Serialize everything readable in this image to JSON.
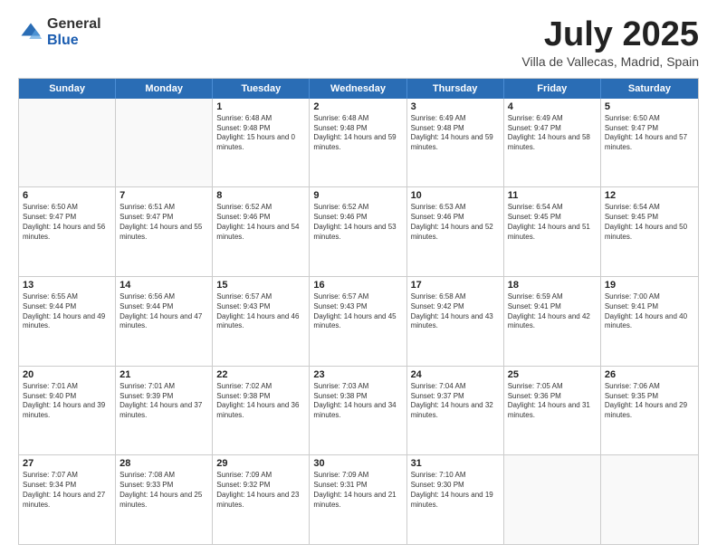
{
  "logo": {
    "general": "General",
    "blue": "Blue"
  },
  "header": {
    "title": "July 2025",
    "subtitle": "Villa de Vallecas, Madrid, Spain"
  },
  "calendar": {
    "days": [
      "Sunday",
      "Monday",
      "Tuesday",
      "Wednesday",
      "Thursday",
      "Friday",
      "Saturday"
    ],
    "rows": [
      [
        {
          "day": "",
          "empty": true
        },
        {
          "day": "",
          "empty": true
        },
        {
          "day": "1",
          "sunrise": "Sunrise: 6:48 AM",
          "sunset": "Sunset: 9:48 PM",
          "daylight": "Daylight: 15 hours and 0 minutes."
        },
        {
          "day": "2",
          "sunrise": "Sunrise: 6:48 AM",
          "sunset": "Sunset: 9:48 PM",
          "daylight": "Daylight: 14 hours and 59 minutes."
        },
        {
          "day": "3",
          "sunrise": "Sunrise: 6:49 AM",
          "sunset": "Sunset: 9:48 PM",
          "daylight": "Daylight: 14 hours and 59 minutes."
        },
        {
          "day": "4",
          "sunrise": "Sunrise: 6:49 AM",
          "sunset": "Sunset: 9:47 PM",
          "daylight": "Daylight: 14 hours and 58 minutes."
        },
        {
          "day": "5",
          "sunrise": "Sunrise: 6:50 AM",
          "sunset": "Sunset: 9:47 PM",
          "daylight": "Daylight: 14 hours and 57 minutes."
        }
      ],
      [
        {
          "day": "6",
          "sunrise": "Sunrise: 6:50 AM",
          "sunset": "Sunset: 9:47 PM",
          "daylight": "Daylight: 14 hours and 56 minutes."
        },
        {
          "day": "7",
          "sunrise": "Sunrise: 6:51 AM",
          "sunset": "Sunset: 9:47 PM",
          "daylight": "Daylight: 14 hours and 55 minutes."
        },
        {
          "day": "8",
          "sunrise": "Sunrise: 6:52 AM",
          "sunset": "Sunset: 9:46 PM",
          "daylight": "Daylight: 14 hours and 54 minutes."
        },
        {
          "day": "9",
          "sunrise": "Sunrise: 6:52 AM",
          "sunset": "Sunset: 9:46 PM",
          "daylight": "Daylight: 14 hours and 53 minutes."
        },
        {
          "day": "10",
          "sunrise": "Sunrise: 6:53 AM",
          "sunset": "Sunset: 9:46 PM",
          "daylight": "Daylight: 14 hours and 52 minutes."
        },
        {
          "day": "11",
          "sunrise": "Sunrise: 6:54 AM",
          "sunset": "Sunset: 9:45 PM",
          "daylight": "Daylight: 14 hours and 51 minutes."
        },
        {
          "day": "12",
          "sunrise": "Sunrise: 6:54 AM",
          "sunset": "Sunset: 9:45 PM",
          "daylight": "Daylight: 14 hours and 50 minutes."
        }
      ],
      [
        {
          "day": "13",
          "sunrise": "Sunrise: 6:55 AM",
          "sunset": "Sunset: 9:44 PM",
          "daylight": "Daylight: 14 hours and 49 minutes."
        },
        {
          "day": "14",
          "sunrise": "Sunrise: 6:56 AM",
          "sunset": "Sunset: 9:44 PM",
          "daylight": "Daylight: 14 hours and 47 minutes."
        },
        {
          "day": "15",
          "sunrise": "Sunrise: 6:57 AM",
          "sunset": "Sunset: 9:43 PM",
          "daylight": "Daylight: 14 hours and 46 minutes."
        },
        {
          "day": "16",
          "sunrise": "Sunrise: 6:57 AM",
          "sunset": "Sunset: 9:43 PM",
          "daylight": "Daylight: 14 hours and 45 minutes."
        },
        {
          "day": "17",
          "sunrise": "Sunrise: 6:58 AM",
          "sunset": "Sunset: 9:42 PM",
          "daylight": "Daylight: 14 hours and 43 minutes."
        },
        {
          "day": "18",
          "sunrise": "Sunrise: 6:59 AM",
          "sunset": "Sunset: 9:41 PM",
          "daylight": "Daylight: 14 hours and 42 minutes."
        },
        {
          "day": "19",
          "sunrise": "Sunrise: 7:00 AM",
          "sunset": "Sunset: 9:41 PM",
          "daylight": "Daylight: 14 hours and 40 minutes."
        }
      ],
      [
        {
          "day": "20",
          "sunrise": "Sunrise: 7:01 AM",
          "sunset": "Sunset: 9:40 PM",
          "daylight": "Daylight: 14 hours and 39 minutes."
        },
        {
          "day": "21",
          "sunrise": "Sunrise: 7:01 AM",
          "sunset": "Sunset: 9:39 PM",
          "daylight": "Daylight: 14 hours and 37 minutes."
        },
        {
          "day": "22",
          "sunrise": "Sunrise: 7:02 AM",
          "sunset": "Sunset: 9:38 PM",
          "daylight": "Daylight: 14 hours and 36 minutes."
        },
        {
          "day": "23",
          "sunrise": "Sunrise: 7:03 AM",
          "sunset": "Sunset: 9:38 PM",
          "daylight": "Daylight: 14 hours and 34 minutes."
        },
        {
          "day": "24",
          "sunrise": "Sunrise: 7:04 AM",
          "sunset": "Sunset: 9:37 PM",
          "daylight": "Daylight: 14 hours and 32 minutes."
        },
        {
          "day": "25",
          "sunrise": "Sunrise: 7:05 AM",
          "sunset": "Sunset: 9:36 PM",
          "daylight": "Daylight: 14 hours and 31 minutes."
        },
        {
          "day": "26",
          "sunrise": "Sunrise: 7:06 AM",
          "sunset": "Sunset: 9:35 PM",
          "daylight": "Daylight: 14 hours and 29 minutes."
        }
      ],
      [
        {
          "day": "27",
          "sunrise": "Sunrise: 7:07 AM",
          "sunset": "Sunset: 9:34 PM",
          "daylight": "Daylight: 14 hours and 27 minutes."
        },
        {
          "day": "28",
          "sunrise": "Sunrise: 7:08 AM",
          "sunset": "Sunset: 9:33 PM",
          "daylight": "Daylight: 14 hours and 25 minutes."
        },
        {
          "day": "29",
          "sunrise": "Sunrise: 7:09 AM",
          "sunset": "Sunset: 9:32 PM",
          "daylight": "Daylight: 14 hours and 23 minutes."
        },
        {
          "day": "30",
          "sunrise": "Sunrise: 7:09 AM",
          "sunset": "Sunset: 9:31 PM",
          "daylight": "Daylight: 14 hours and 21 minutes."
        },
        {
          "day": "31",
          "sunrise": "Sunrise: 7:10 AM",
          "sunset": "Sunset: 9:30 PM",
          "daylight": "Daylight: 14 hours and 19 minutes."
        },
        {
          "day": "",
          "empty": true
        },
        {
          "day": "",
          "empty": true
        }
      ]
    ]
  }
}
